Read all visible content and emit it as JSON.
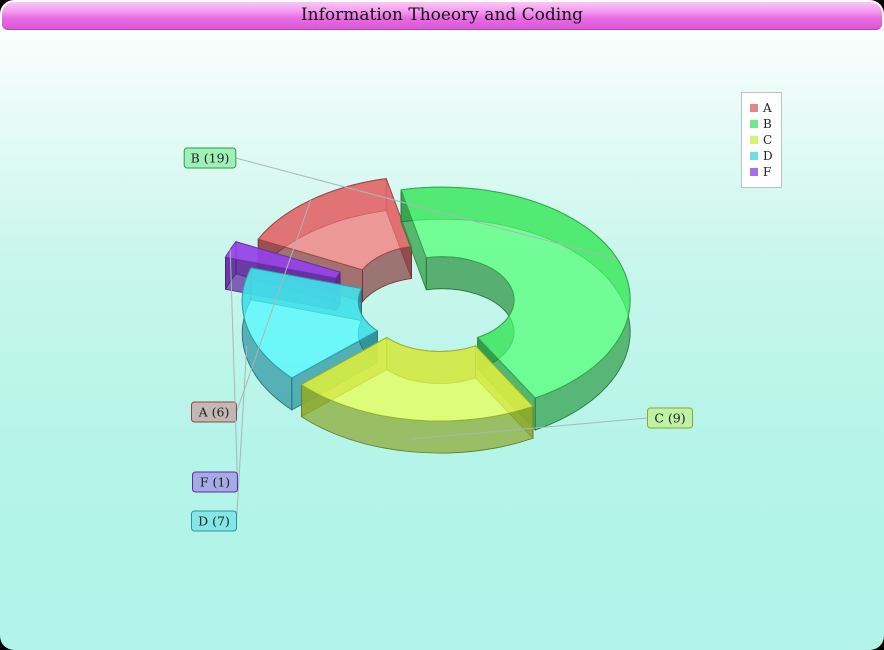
{
  "title": "Information Thoeory and Coding",
  "chart_data": {
    "type": "pie",
    "style": "3d-donut-exploded",
    "categories": [
      "A",
      "B",
      "C",
      "D",
      "F"
    ],
    "values": [
      6,
      19,
      9,
      7,
      1
    ],
    "colors": [
      "#d35f61",
      "#41e061",
      "#c8f03f",
      "#3ed2e2",
      "#8b3ee0"
    ],
    "data_labels": [
      "A (6)",
      "B (19)",
      "C (9)",
      "D (7)",
      "F (1)"
    ],
    "legend": {
      "position": "top-right",
      "items": [
        "A",
        "B",
        "C",
        "D",
        "F"
      ]
    }
  }
}
